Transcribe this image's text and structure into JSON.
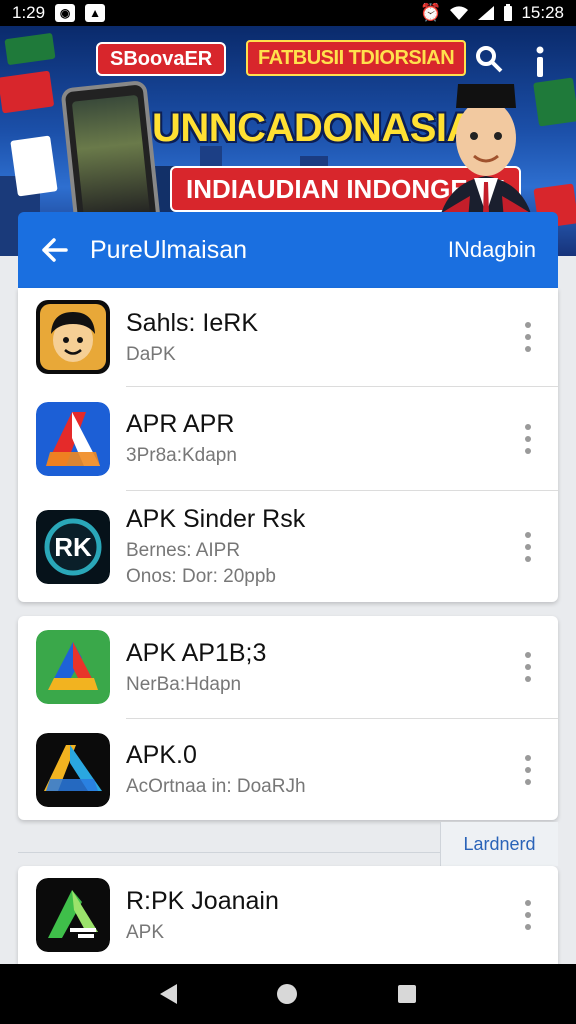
{
  "status_bar": {
    "time_left": "1:29",
    "time_right": "15:28"
  },
  "banner": {
    "brand_left": "SBoovaER",
    "brand_right": "FATBUSII TDIORSIAN",
    "headline": "UNNCADONASIA",
    "ribbon": "INDIAUDIAN INDONGEAN"
  },
  "app_bar": {
    "title": "PureUlmaisan",
    "action": "INdagbin"
  },
  "card1": {
    "items": [
      {
        "name": "Sahls: IeRK",
        "sub": "DaPK",
        "icon": "face-app-icon"
      },
      {
        "name": "APR  APR",
        "sub": "3Pr8a:Kdapn",
        "icon": "red-a-app-icon"
      },
      {
        "name": "APK Sinder Rsk",
        "sub": "Bernes: AIPR",
        "sub2": "Onos: Dor: 20ppb",
        "icon": "rk-circle-app-icon"
      }
    ]
  },
  "card2": {
    "items": [
      {
        "name": "APK AP1B;3",
        "sub": "NerBa:Hdapn",
        "icon": "colorful-a-app-icon"
      },
      {
        "name": "APK.0",
        "sub": "AcOrtnaa in: DoaRJh",
        "icon": "dark-a-app-icon"
      }
    ]
  },
  "section_label": "Lardnerd",
  "card3": {
    "items": [
      {
        "name": "R:PK Joanain",
        "sub": "APK",
        "icon": "green-a-app-icon"
      }
    ]
  },
  "colors": {
    "appbar": "#1a6fe0",
    "status_bar": "#000000"
  }
}
